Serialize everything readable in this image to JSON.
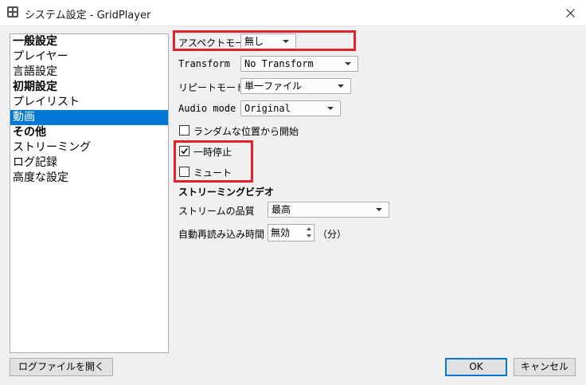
{
  "window": {
    "title": "システム設定 - GridPlayer"
  },
  "sidebar": {
    "items": [
      {
        "label": "一般設定",
        "bold": true
      },
      {
        "label": "プレイヤー"
      },
      {
        "label": "言語設定"
      },
      {
        "label": "初期設定",
        "bold": true
      },
      {
        "label": "プレイリスト"
      },
      {
        "label": "動画",
        "selected": true
      },
      {
        "label": "その他",
        "bold": true
      },
      {
        "label": "ストリーミング"
      },
      {
        "label": "ログ記録"
      },
      {
        "label": "高度な設定"
      }
    ]
  },
  "video": {
    "aspect_label": "アスペクトモード",
    "aspect_value": "無し",
    "transform_label": "Transform",
    "transform_value": "No Transform",
    "repeat_label": "リピートモード",
    "repeat_value": "単一ファイル",
    "audio_label": "Audio mode",
    "audio_value": "Original",
    "random_start_label": "ランダムな位置から開始",
    "random_start_checked": false,
    "pause_label": "一時停止",
    "pause_checked": true,
    "mute_label": "ミュート",
    "mute_checked": false
  },
  "streaming": {
    "section_title": "ストリーミングビデオ",
    "quality_label": "ストリームの品質",
    "quality_value": "最高",
    "reload_label": "自動再読み込み時間",
    "reload_value": "無効",
    "reload_unit": "（分）"
  },
  "buttons": {
    "log_label": "ログファイルを開く",
    "ok_label": "OK",
    "cancel_label": "キャンセル"
  },
  "colors": {
    "selection": "#0078d7",
    "highlight": "#e0202b"
  }
}
